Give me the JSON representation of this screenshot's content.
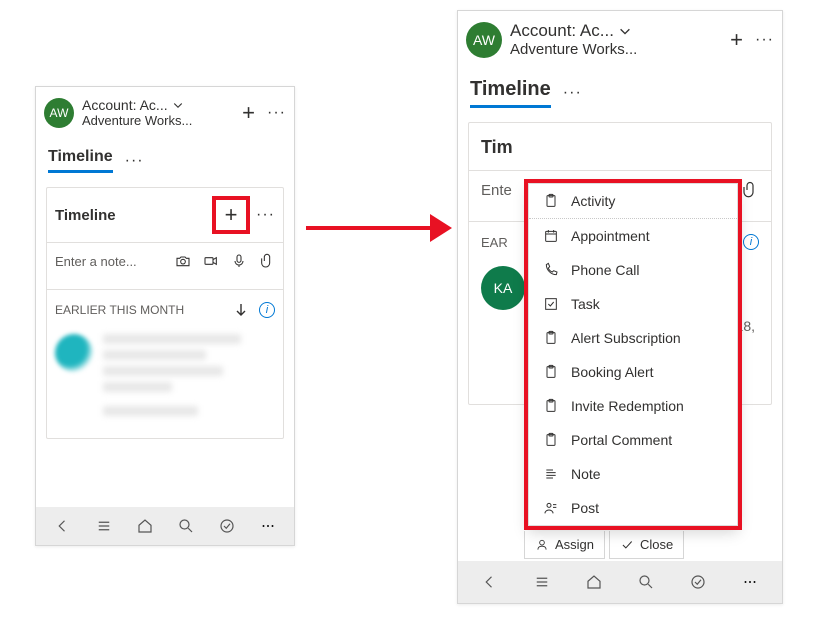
{
  "header": {
    "avatar_initials": "AW",
    "title": "Account: Ac...",
    "subtitle": "Adventure Works..."
  },
  "tabs": {
    "active": "Timeline"
  },
  "card": {
    "title": "Timeline",
    "note_placeholder": "Enter a note...",
    "section_label": "EARLIER THIS MONTH"
  },
  "right": {
    "card_title": "Tim",
    "note_placeholder_short": "Ente",
    "section_label_short": "EAR",
    "ka_initials": "KA",
    "partial_text": "18,",
    "assign_label": "Assign",
    "close_label": "Close"
  },
  "menu": {
    "items": [
      "Activity",
      "Appointment",
      "Phone Call",
      "Task",
      "Alert Subscription",
      "Booking Alert",
      "Invite Redemption",
      "Portal Comment",
      "Note",
      "Post"
    ]
  }
}
